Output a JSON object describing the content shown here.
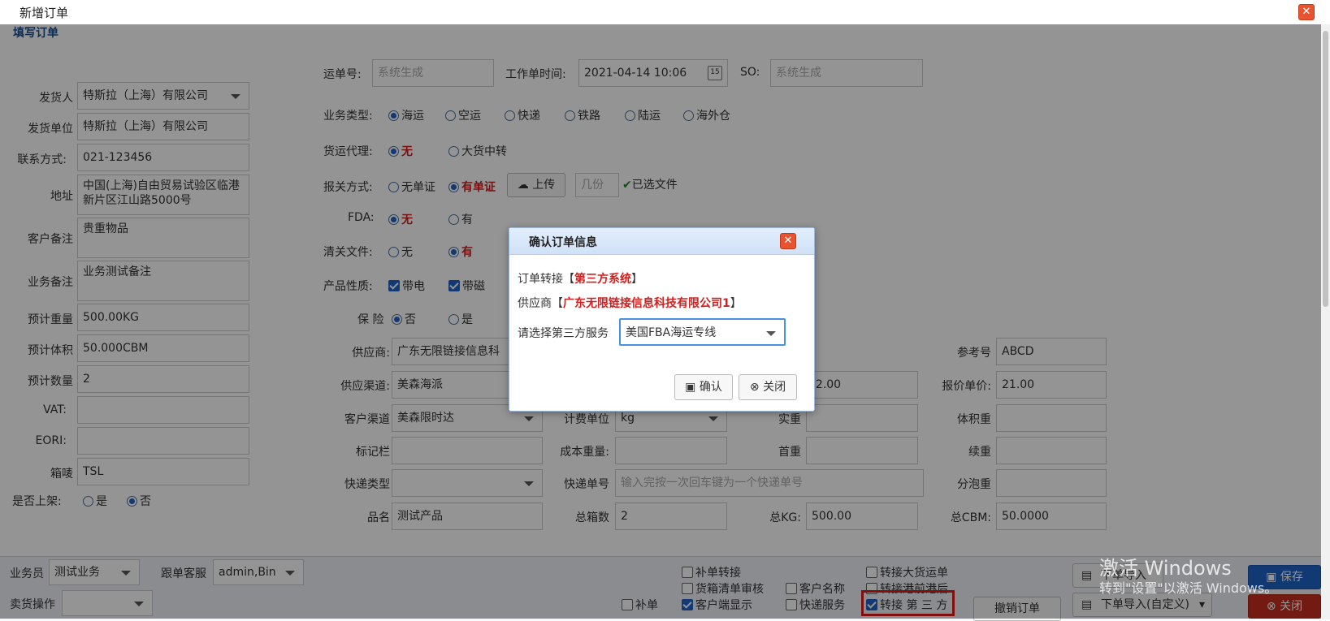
{
  "window": {
    "title": "新增订单"
  },
  "section_title": "填写订单",
  "left_fields": [
    {
      "label": "发货人",
      "value": "特斯拉（上海）有限公司",
      "type": "select"
    },
    {
      "label": "发货单位",
      "value": "特斯拉（上海）有限公司",
      "type": "input"
    },
    {
      "label": "联系方式:",
      "value": "021-123456",
      "type": "input"
    },
    {
      "label": "地址",
      "value": "中国(上海)自由贸易试验区临港新片区江山路5000号",
      "type": "textarea"
    },
    {
      "label": "客户备注",
      "value": "贵重物品",
      "type": "textarea"
    },
    {
      "label": "业务备注",
      "value": "业务测试备注",
      "type": "textarea"
    },
    {
      "label": "预计重量",
      "value": "500.00KG",
      "type": "input"
    },
    {
      "label": "预计体积",
      "value": "50.000CBM",
      "type": "input"
    },
    {
      "label": "预计数量",
      "value": "2",
      "type": "input"
    },
    {
      "label": "VAT:",
      "value": "",
      "type": "input"
    },
    {
      "label": "EORI:",
      "value": "",
      "type": "input"
    },
    {
      "label": "箱唛",
      "value": "TSL",
      "type": "input"
    }
  ],
  "shelf": {
    "label": "是否上架:",
    "options": [
      "是",
      "否"
    ],
    "selected": "否"
  },
  "top_row": {
    "waybill_label": "运单号:",
    "waybill_placeholder": "系统生成",
    "worktime_label": "工作单时间:",
    "worktime_value": "2021-04-14 10:06",
    "so_label": "SO:",
    "so_placeholder": "系统生成"
  },
  "business_type": {
    "label": "业务类型:",
    "options": [
      "海运",
      "空运",
      "快递",
      "铁路",
      "陆运",
      "海外仓"
    ],
    "selected": "海运"
  },
  "freight_agent": {
    "label": "货运代理:",
    "options": [
      "无",
      "大货中转"
    ],
    "selected": "无"
  },
  "customs": {
    "label": "报关方式:",
    "options": [
      "无单证",
      "有单证"
    ],
    "selected": "有单证",
    "upload_label": "上传",
    "copies_placeholder": "几份",
    "selected_file": "已选文件"
  },
  "fda": {
    "label": "FDA:",
    "options": [
      "无",
      "有"
    ],
    "selected": "无"
  },
  "clearance": {
    "label": "清关文件:",
    "options": [
      "无",
      "有"
    ],
    "selected": "有"
  },
  "product_nature": {
    "label": "产品性质:",
    "options": [
      "带电",
      "带磁"
    ]
  },
  "insurance": {
    "label": "保 险",
    "options": [
      "否",
      "是"
    ],
    "selected": "否"
  },
  "grid": {
    "supplier_label": "供应商:",
    "supplier_value": "广东无限链接信息科",
    "ref_label": "参考号",
    "ref_value": "ABCD",
    "channel_label": "供应渠道:",
    "channel_value": "美森海派",
    "hidden_value": "12.00",
    "quote_label": "报价单价:",
    "quote_value": "21.00",
    "cust_channel_label": "客户渠道",
    "cust_channel_value": "美森限时达",
    "unit_label": "计费单位",
    "unit_value": "kg",
    "actual_weight_label": "实重",
    "volume_weight_label": "体积重",
    "mark_label": "标记栏",
    "cost_weight_label": "成本重量:",
    "first_weight_label": "首重",
    "extra_weight_label": "续重",
    "express_type_label": "快递类型",
    "express_no_label": "快递单号",
    "express_no_placeholder": "输入完按一次回车键为一个快递单号",
    "bubble_label": "分泡重",
    "product_label": "品名",
    "product_value": "测试产品",
    "boxes_label": "总箱数",
    "boxes_value": "2",
    "kg_label": "总KG:",
    "kg_value": "500.00",
    "cbm_label": "总CBM:",
    "cbm_value": "50.0000"
  },
  "footer": {
    "salesman_label": "业务员",
    "salesman_value": "测试业务",
    "cs_label": "跟单客服",
    "cs_value": "admin,Bin",
    "seller_label": "卖货操作",
    "seller_value": "",
    "checks": [
      {
        "label": "补单转接",
        "checked": false
      },
      {
        "label": "转接大货运单",
        "checked": false
      },
      {
        "label": "货箱清单审核",
        "checked": false
      },
      {
        "label": "客户名称",
        "checked": false
      },
      {
        "label": "转接港前港后",
        "checked": false
      },
      {
        "label": "补单",
        "checked": false
      },
      {
        "label": "客户端显示",
        "checked": true
      },
      {
        "label": "快递服务",
        "checked": false
      },
      {
        "label": "转接 第 三 方",
        "checked": true
      }
    ],
    "cancel_label": "撤销订单",
    "import_label": "下单导入",
    "import_custom_label": "下单导入(自定义)",
    "save_label": "保存",
    "close_label": "关闭"
  },
  "watermark": {
    "line1": "激活 Windows",
    "line2": "转到\"设置\"以激活 Windows。"
  },
  "dialog": {
    "title": "确认订单信息",
    "transfer_prefix": "订单转接【",
    "transfer_value": "第三方系统",
    "transfer_suffix": "】",
    "supplier_prefix": "供应商【",
    "supplier_value": "广东无限链接信息科技有限公司1",
    "supplier_suffix": "】",
    "service_label": "请选择第三方服务",
    "service_value": "美国FBA海运专线",
    "confirm_label": "确认",
    "close_label": "关闭"
  },
  "colors": {
    "accent": "#1f62c9",
    "danger": "#d21e1e",
    "highlight": "#e11b1b",
    "save": "#1e62c6",
    "close": "#c7301f"
  }
}
